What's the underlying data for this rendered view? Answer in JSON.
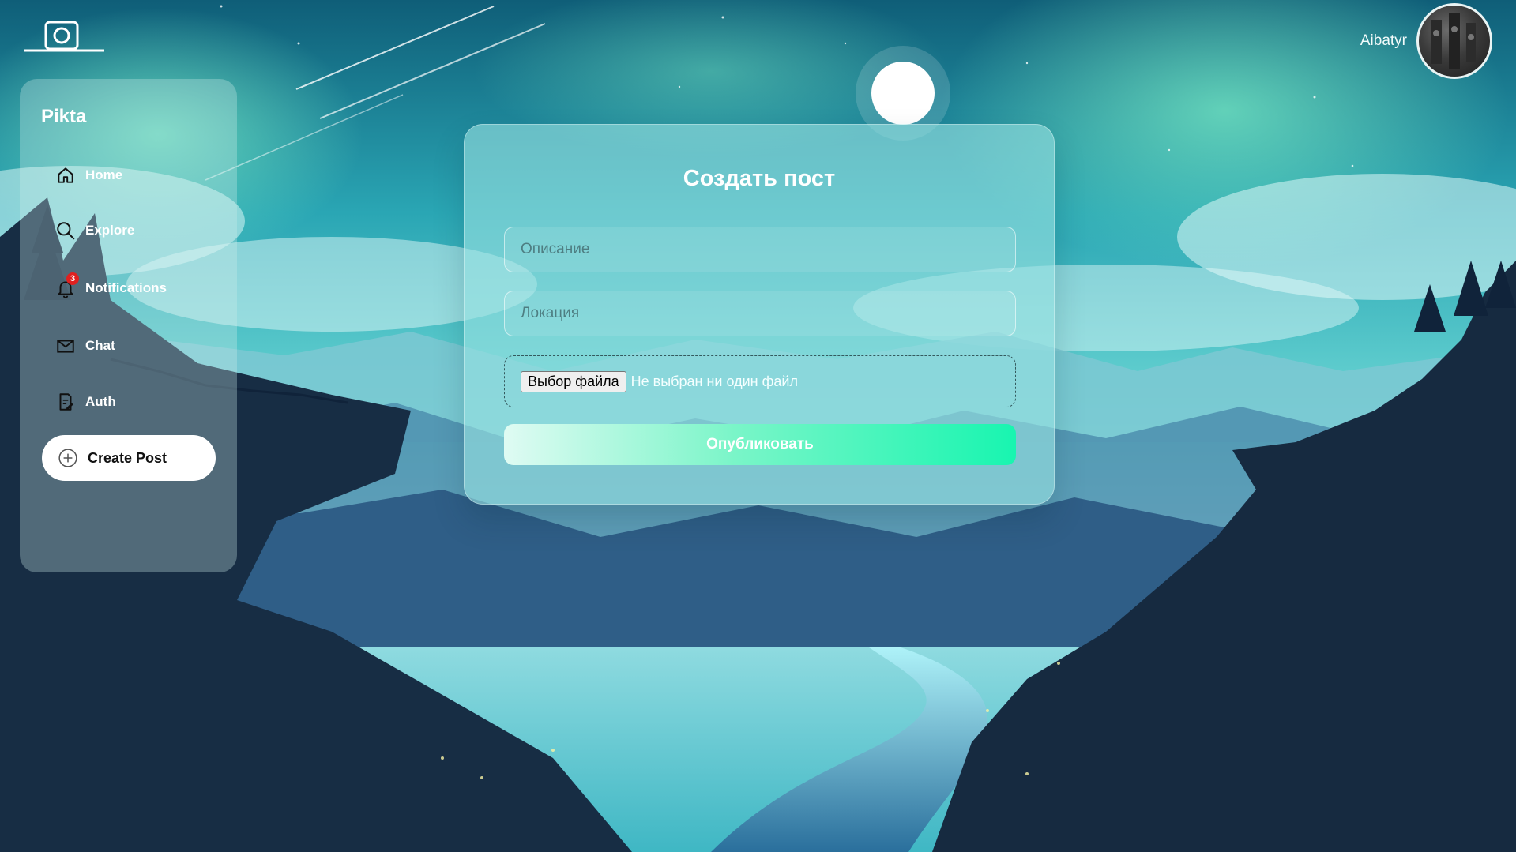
{
  "app": {
    "brand": "Pikta",
    "logo_icon": "camera-icon"
  },
  "user": {
    "name": "Aibatyr"
  },
  "sidebar": {
    "items": [
      {
        "label": "Home",
        "icon": "home-icon"
      },
      {
        "label": "Explore",
        "icon": "search-icon"
      },
      {
        "label": "Notifications",
        "icon": "bell-icon",
        "badge": "3"
      },
      {
        "label": "Chat",
        "icon": "mail-icon"
      },
      {
        "label": "Auth",
        "icon": "document-edit-icon"
      }
    ],
    "create_button": {
      "label": "Create Post",
      "icon": "plus-circle-icon"
    }
  },
  "form": {
    "title": "Создать пост",
    "description_placeholder": "Описание",
    "location_placeholder": "Локация",
    "file_button_label": "Выбор файла",
    "file_status": "Не выбран ни один файл",
    "submit_label": "Опубликовать"
  },
  "colors": {
    "badge": "#e02020",
    "publish_gradient_start": "#dffbf3",
    "publish_gradient_end": "#18f5b0"
  }
}
